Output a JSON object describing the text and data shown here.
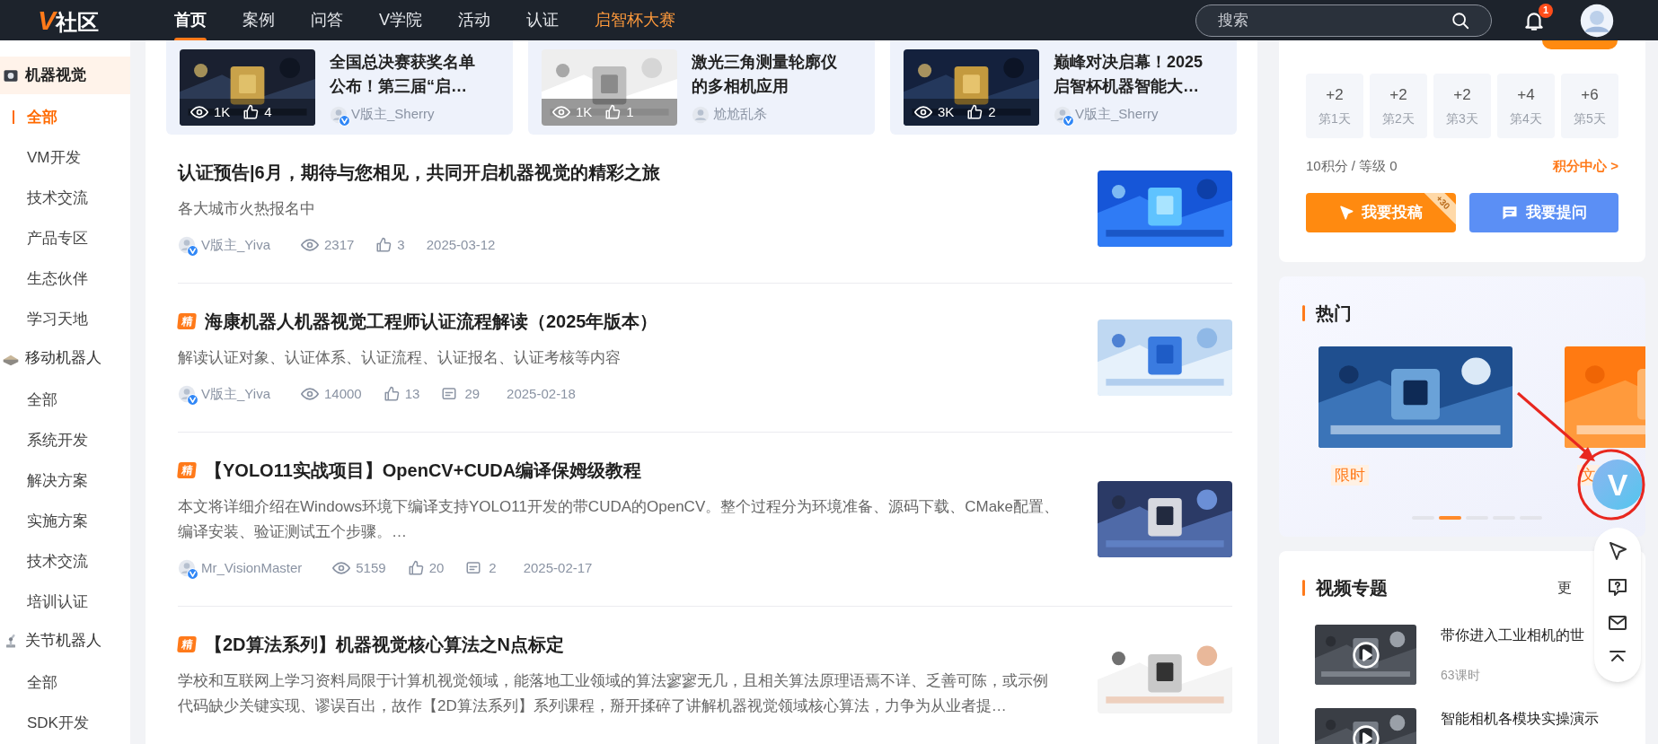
{
  "nav": {
    "logo": {
      "mark": "V",
      "text": "社区"
    },
    "items": [
      {
        "label": "首页",
        "selected": true,
        "kind": "normal"
      },
      {
        "label": "案例",
        "selected": false,
        "kind": "normal"
      },
      {
        "label": "问答",
        "selected": false,
        "kind": "normal"
      },
      {
        "label": "V学院",
        "selected": false,
        "kind": "normal"
      },
      {
        "label": "活动",
        "selected": false,
        "kind": "normal"
      },
      {
        "label": "认证",
        "selected": false,
        "kind": "normal"
      },
      {
        "label": "启智杯大赛",
        "selected": false,
        "kind": "highlight"
      }
    ],
    "search": {
      "placeholder": "搜索"
    },
    "notification_count": "1"
  },
  "sidebar": {
    "sections": [
      {
        "label": "机器视觉",
        "kind": "camera",
        "selected": true,
        "children": [
          {
            "label": "全部",
            "selected": true
          },
          {
            "label": "VM开发",
            "selected": false
          },
          {
            "label": "技术交流",
            "selected": false
          },
          {
            "label": "产品专区",
            "selected": false
          },
          {
            "label": "生态伙伴",
            "selected": false
          },
          {
            "label": "学习天地",
            "selected": false
          }
        ]
      },
      {
        "label": "移动机器人",
        "kind": "vehicle",
        "selected": false,
        "children": [
          {
            "label": "全部",
            "selected": false
          },
          {
            "label": "系统开发",
            "selected": false
          },
          {
            "label": "解决方案",
            "selected": false
          },
          {
            "label": "实施方案",
            "selected": false
          },
          {
            "label": "技术交流",
            "selected": false
          },
          {
            "label": "培训认证",
            "selected": false
          }
        ]
      },
      {
        "label": "关节机器人",
        "kind": "arm",
        "selected": false,
        "children": [
          {
            "label": "全部",
            "selected": false
          },
          {
            "label": "SDK开发",
            "selected": false
          }
        ]
      }
    ]
  },
  "featured_cards": [
    {
      "title": "全国总决赛获奖名单公布！第三届“启…",
      "views": "1K",
      "likes": "4",
      "author": "V版主_Sherry",
      "verified": true
    },
    {
      "title": "激光三角测量轮廓仪的多相机应用",
      "views": "1K",
      "likes": "1",
      "author": "尬尬乱杀",
      "verified": false
    },
    {
      "title": "巅峰对决启幕！2025启智杯机器智能大…",
      "views": "3K",
      "likes": "2",
      "author": "V版主_Sherry",
      "verified": true
    }
  ],
  "articles": [
    {
      "title": "认证预告|6月，期待与您相见，共同开启机器视觉的精彩之旅",
      "summary": "各大城市火热报名中",
      "author": "V版主_Yiva",
      "verified": true,
      "views": "2317",
      "likes": "3",
      "date": "2025-03-12"
    },
    {
      "badge": "精",
      "title": "海康机器人机器视觉工程师认证流程解读（2025年版本）",
      "summary": "解读认证对象、认证体系、认证流程、认证报名、认证考核等内容",
      "author": "V版主_Yiva",
      "verified": true,
      "views": "14000",
      "likes": "13",
      "comments": "29",
      "date": "2025-02-18"
    },
    {
      "badge": "精",
      "title": "【YOLO11实战项目】OpenCV+CUDA编译保姆级教程",
      "summary": "本文将详细介绍在Windows环境下编译支持YOLO11开发的带CUDA的OpenCV。整个过程分为环境准备、源码下载、CMake配置、编译安装、验证测试五个步骤。…",
      "author": "Mr_VisionMaster",
      "verified": true,
      "views": "5159",
      "likes": "20",
      "comments": "2",
      "date": "2025-02-17"
    },
    {
      "badge": "精",
      "title": "【2D算法系列】机器视觉核心算法之N点标定",
      "summary": "学校和互联网上学习资料局限于计算机视觉领域，能落地工业领域的算法寥寥无几，且相关算法原理语焉不详、乏善可陈，或示例代码缺少关键实现、谬误百出，故作【2D算法系列】系列课程，掰开揉碎了讲解机器视觉领域核心算法，力争为从业者提…"
    }
  ],
  "checkin": {
    "days": [
      {
        "points": "+2",
        "label": "第1天"
      },
      {
        "points": "+2",
        "label": "第2天"
      },
      {
        "points": "+2",
        "label": "第3天"
      },
      {
        "points": "+4",
        "label": "第4天"
      },
      {
        "points": "+6",
        "label": "第5天"
      }
    ],
    "summary": "10积分 / 等级 0",
    "link": "积分中心 >",
    "buttons": [
      {
        "label": "我要投稿",
        "kind": "post",
        "bonus": "+30"
      },
      {
        "label": "我要提问",
        "kind": "ask"
      }
    ]
  },
  "hot": {
    "title": "热门",
    "slides": [
      {
        "tag": "限时"
      },
      {
        "tag": "文"
      }
    ],
    "dots": [
      {
        "selected": false
      },
      {
        "selected": true
      },
      {
        "selected": false
      },
      {
        "selected": false
      },
      {
        "selected": false
      }
    ]
  },
  "videos": {
    "title": "视频专题",
    "more": "更",
    "items": [
      {
        "title": "带你进入工业相机的世",
        "lessons": "63课时"
      },
      {
        "title": "智能相机各模块实操演示"
      }
    ]
  },
  "float_tools": {
    "logo": "V",
    "tools": [
      {
        "kind": "post"
      },
      {
        "kind": "question"
      },
      {
        "kind": "mail"
      },
      {
        "kind": "top"
      }
    ]
  }
}
